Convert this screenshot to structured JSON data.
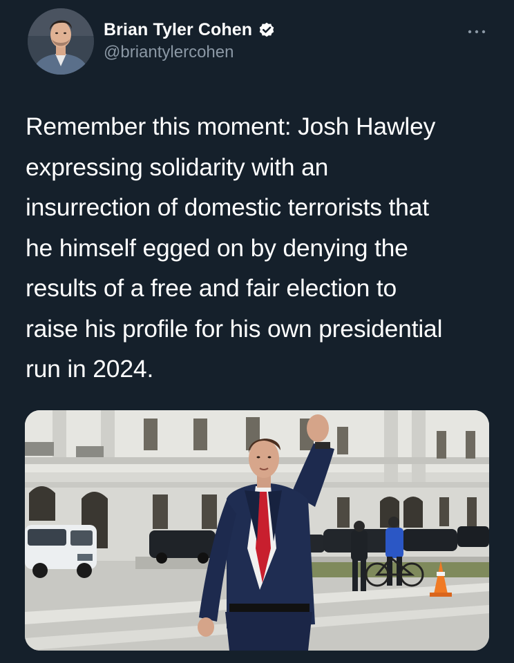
{
  "author": {
    "display_name": "Brian Tyler Cohen",
    "handle": "@briantylercohen",
    "verified": true,
    "avatar_icon": "profile-photo"
  },
  "tweet": {
    "text": "Remember this moment: Josh Hawley\nexpressing solidarity with an\ninsurrection of domestic terrorists that\nhe himself egged on by denying the\nresults of a free and fair election to\nraise his profile for his own presidential\nrun in 2024."
  },
  "media": {
    "kind": "photo",
    "subject": "man in navy suit raising fist outside capitol building"
  },
  "colors": {
    "background": "#15202b",
    "text_primary": "#ffffff",
    "text_secondary": "#8b98a5",
    "verified_badge": "#ffffff"
  },
  "icons": {
    "more": "more-options-icon",
    "verified": "verified-badge-icon"
  }
}
